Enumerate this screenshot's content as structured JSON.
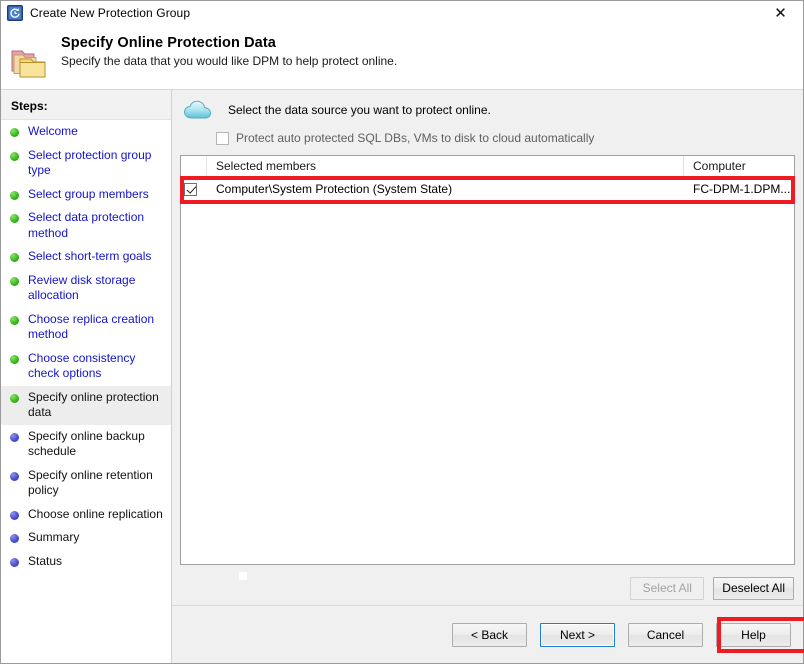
{
  "window": {
    "title": "Create New Protection Group",
    "title_icon": "dpm-recovery-icon",
    "close_label": "✕"
  },
  "header": {
    "icon": "folders-icon",
    "title": "Specify Online Protection Data",
    "subtitle": "Specify the data that you would like DPM to help protect online."
  },
  "sidebar": {
    "heading": "Steps:",
    "items": [
      {
        "label": "Welcome",
        "state": "done"
      },
      {
        "label": "Select protection group type",
        "state": "done"
      },
      {
        "label": "Select group members",
        "state": "done"
      },
      {
        "label": "Select data protection method",
        "state": "done"
      },
      {
        "label": "Select short-term goals",
        "state": "done"
      },
      {
        "label": "Review disk storage allocation",
        "state": "done"
      },
      {
        "label": "Choose replica creation method",
        "state": "done"
      },
      {
        "label": "Choose consistency check options",
        "state": "done"
      },
      {
        "label": "Specify online protection data",
        "state": "active"
      },
      {
        "label": "Specify online backup schedule",
        "state": "future"
      },
      {
        "label": "Specify online retention policy",
        "state": "future"
      },
      {
        "label": "Choose online replication",
        "state": "future"
      },
      {
        "label": "Summary",
        "state": "future"
      },
      {
        "label": "Status",
        "state": "future"
      }
    ]
  },
  "main": {
    "cloud_icon": "cloud-icon",
    "instruction": "Select the data source you want to protect online.",
    "auto_protect": {
      "label": "Protect auto protected SQL DBs, VMs to disk to cloud automatically",
      "checked": false,
      "enabled": false
    },
    "table": {
      "columns": [
        "Selected members",
        "Computer"
      ],
      "rows": [
        {
          "checked": true,
          "selected_member": "Computer\\System Protection (System State)",
          "computer": "FC-DPM-1.DPM..."
        }
      ]
    },
    "select_all_label": "Select All",
    "select_all_enabled": false,
    "deselect_all_label": "Deselect All",
    "deselect_all_enabled": true
  },
  "footer": {
    "back_label": "< Back",
    "next_label": "Next >",
    "cancel_label": "Cancel",
    "help_label": "Help"
  },
  "annotations": {
    "highlight_color": "#ee1b22",
    "targets": [
      "selected-member-row",
      "next-button"
    ]
  }
}
